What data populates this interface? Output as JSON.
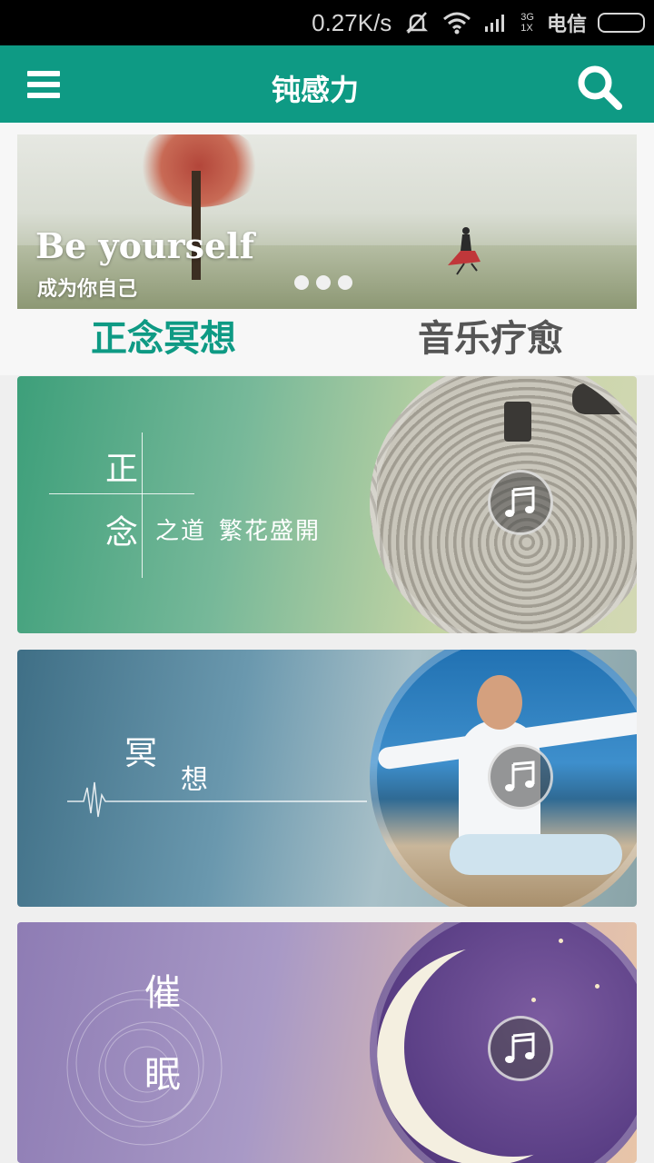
{
  "status_bar": {
    "speed": "0.27K/s",
    "network_top": "3G",
    "network_bottom": "1X",
    "carrier": "电信"
  },
  "toolbar": {
    "title": "钝感力"
  },
  "banner": {
    "headline": "Be yourself",
    "subline": "成为你自己",
    "page_count": 3
  },
  "tabs": [
    {
      "label": "正念冥想",
      "active": true
    },
    {
      "label": "音乐疗愈",
      "active": false
    }
  ],
  "cards": [
    {
      "char1": "正",
      "char2": "念",
      "suffix_a": "之道",
      "suffix_b": "繁花盛開"
    },
    {
      "char1": "冥",
      "char2": "想"
    },
    {
      "char1": "催",
      "char2": "眠"
    }
  ],
  "colors": {
    "accent": "#0e9a84"
  }
}
